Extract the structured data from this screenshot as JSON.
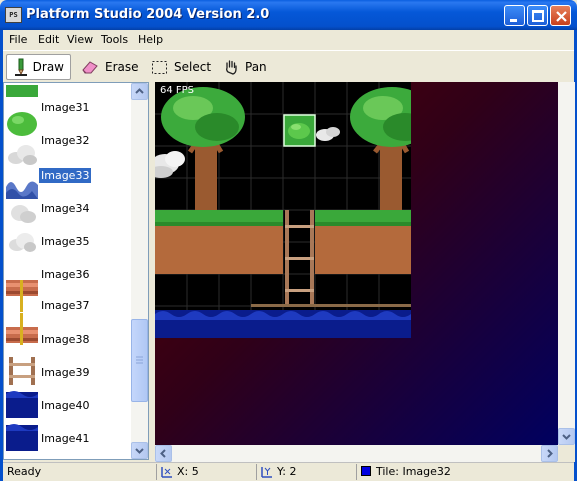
{
  "window": {
    "title": "Platform Studio 2004 Version 2.0",
    "app_icon_text": "PS"
  },
  "menu": [
    "File",
    "Edit",
    "View",
    "Tools",
    "Help"
  ],
  "toolbar": {
    "draw": "Draw",
    "erase": "Erase",
    "select": "Select",
    "pan": "Pan",
    "active_tool": "Draw"
  },
  "images": [
    {
      "label": "Image31",
      "selected": false
    },
    {
      "label": "Image32",
      "selected": false
    },
    {
      "label": "Image33",
      "selected": true
    },
    {
      "label": "Image34",
      "selected": false
    },
    {
      "label": "Image35",
      "selected": false
    },
    {
      "label": "Image36",
      "selected": false
    },
    {
      "label": "Image37",
      "selected": false
    },
    {
      "label": "Image38",
      "selected": false
    },
    {
      "label": "Image39",
      "selected": false
    },
    {
      "label": "Image40",
      "selected": false
    },
    {
      "label": "Image41",
      "selected": false
    }
  ],
  "canvas": {
    "fps": "64 FPS"
  },
  "status": {
    "ready": "Ready",
    "x": "X: 5",
    "y": "Y: 2",
    "tile": "Tile: Image32"
  },
  "colors": {
    "selection": "#316ac5",
    "titlebar": "#0558d8",
    "grass": "#3aa83a",
    "dirt": "#b46a3c",
    "water": "#0a1c8c"
  }
}
